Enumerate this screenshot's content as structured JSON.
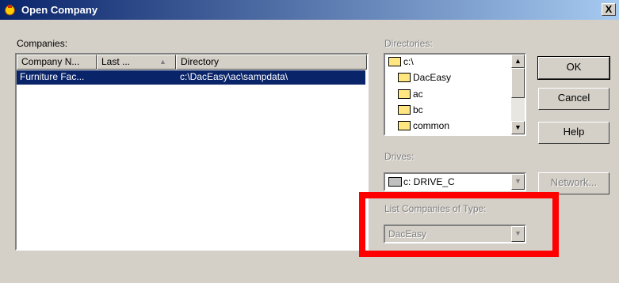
{
  "window": {
    "title": "Open Company",
    "close_label": "X"
  },
  "companies": {
    "label": "Companies:",
    "columns": [
      "Company N...",
      "Last ...",
      "Directory"
    ],
    "rows": [
      {
        "company": "Furniture Fac...",
        "last": "",
        "directory": "c:\\DacEasy\\ac\\sampdata\\"
      }
    ]
  },
  "directories": {
    "label": "Directories:",
    "items": [
      "c:\\",
      "DacEasy",
      "ac",
      "bc",
      "common"
    ]
  },
  "drives": {
    "label": "Drives:",
    "selected": "c: DRIVE_C"
  },
  "list_type": {
    "label": "List Companies of Type:",
    "selected": "DacEasy"
  },
  "buttons": {
    "ok": "OK",
    "cancel": "Cancel",
    "help": "Help",
    "network": "Network..."
  },
  "colors": {
    "title_start": "#0a246a",
    "title_end": "#a6caf0",
    "highlight": "#ff0000"
  }
}
